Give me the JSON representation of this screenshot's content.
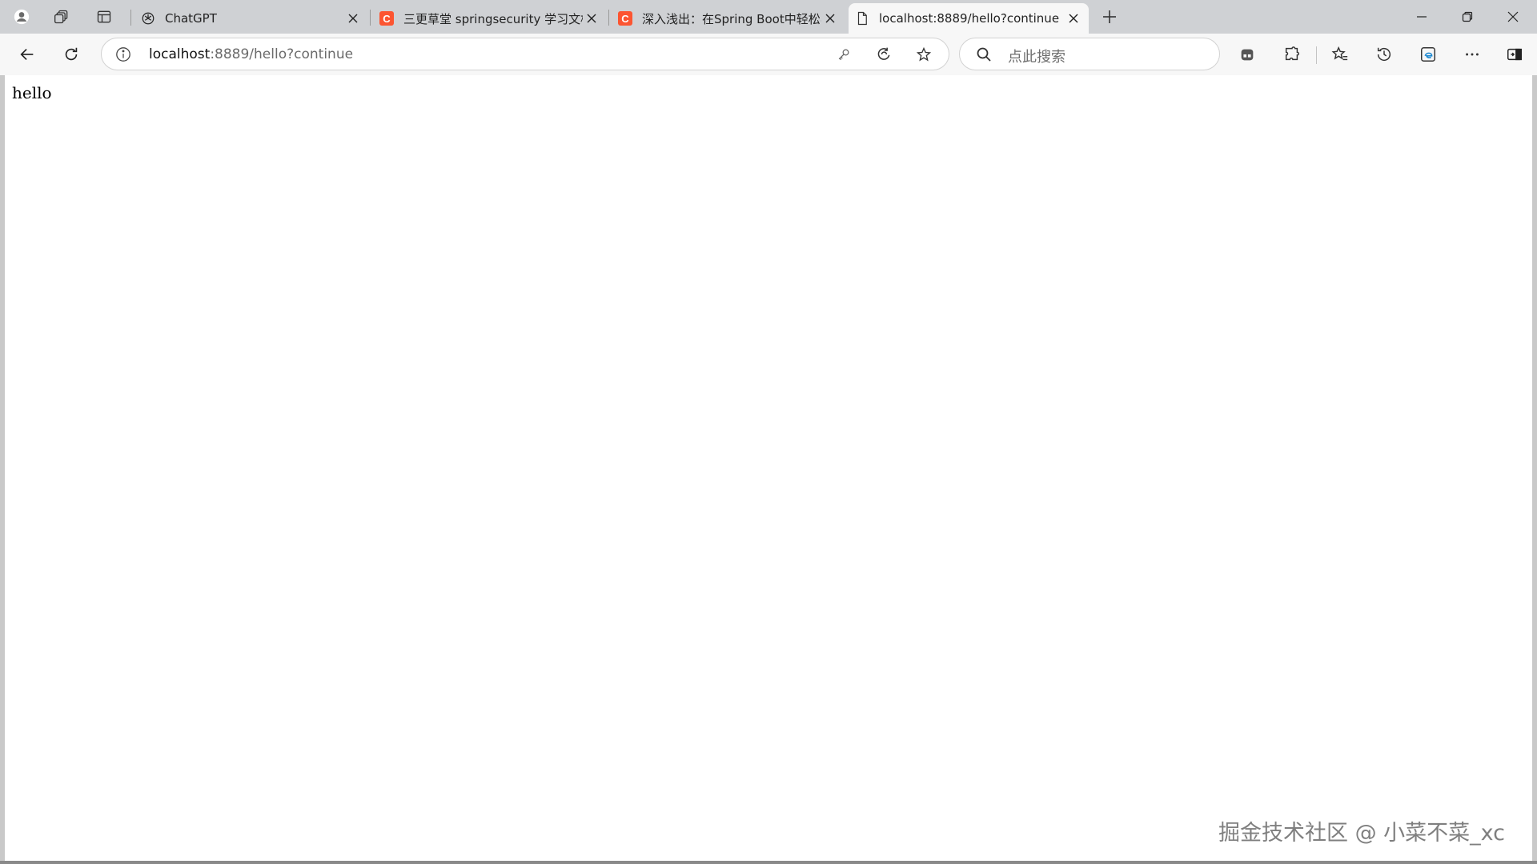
{
  "tabs": [
    {
      "title": "ChatGPT",
      "favicon": "chatgpt-icon",
      "active": false
    },
    {
      "title": "三更草堂 springsecurity 学习文档",
      "favicon": "csdn-icon",
      "favicon_letter": "C",
      "active": false
    },
    {
      "title": "深入浅出：在Spring Boot中轻松实",
      "favicon": "csdn-icon",
      "favicon_letter": "C",
      "active": false
    },
    {
      "title": "localhost:8889/hello?continue",
      "favicon": "page-icon",
      "active": true
    }
  ],
  "address_bar": {
    "host": "localhost",
    "rest": ":8889/hello?continue"
  },
  "search_box": {
    "placeholder": "点此搜索"
  },
  "page": {
    "body_text": "hello"
  },
  "watermark": "掘金技术社区 @ 小菜不菜_xc",
  "colors": {
    "tabstrip_bg": "#cfd1d4",
    "toolbar_bg": "#f7f7f7",
    "csdn_brand": "#fc5531"
  }
}
